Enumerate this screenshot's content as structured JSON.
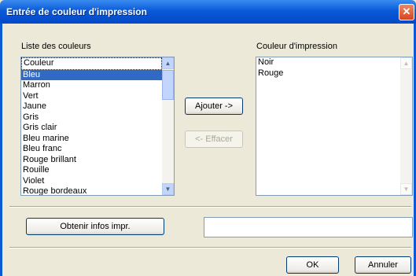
{
  "window": {
    "title": "Entrée de couleur d'impression",
    "close_glyph": "✕"
  },
  "left_list": {
    "label": "Liste des couleurs",
    "items": [
      "Couleur",
      "Bleu",
      "Marron",
      "Vert",
      "Jaune",
      "Gris",
      "Gris clair",
      "Bleu marine",
      "Bleu franc",
      "Rouge brillant",
      "Rouille",
      "Violet",
      "Rouge bordeaux"
    ],
    "selected_index": 1
  },
  "right_list": {
    "label": "Couleur d'impression",
    "items": [
      "Noir",
      "Rouge"
    ]
  },
  "buttons": {
    "add": "Ajouter ->",
    "remove": "<- Effacer",
    "printer_info": "Obtenir infos impr.",
    "ok": "OK",
    "cancel": "Annuler"
  },
  "scroll": {
    "up_glyph": "▲",
    "down_glyph": "▼"
  },
  "printer_info_value": ""
}
